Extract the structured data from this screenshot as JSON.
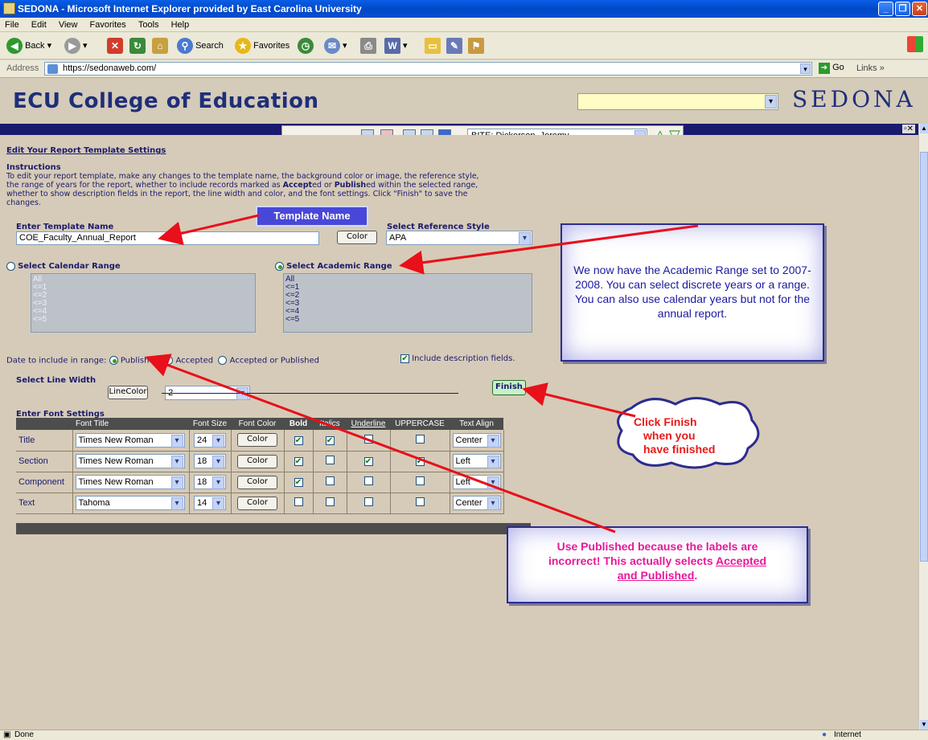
{
  "window": {
    "title": "SEDONA - Microsoft Internet Explorer provided by East Carolina University"
  },
  "menu": [
    "File",
    "Edit",
    "View",
    "Favorites",
    "Tools",
    "Help"
  ],
  "toolbar": {
    "back": "Back",
    "search": "Search",
    "favorites": "Favorites"
  },
  "address": {
    "label": "Address",
    "url": "https://sedonaweb.com/",
    "go": "Go",
    "links": "Links"
  },
  "banner": {
    "college": "ECU College of Education",
    "logo": "SEDONA"
  },
  "nav": {
    "user_select": "BITE: Dickerson, Jeremy"
  },
  "page": {
    "title": "Edit Your Report Template Settings",
    "instructions_heading": "Instructions",
    "instructions_1": "To edit your report template, make any changes to the template name, the background color or image, the reference style,",
    "instructions_2": "the range of years for the report, whether to include records marked as",
    "instructions_accepted": "Accept",
    "instructions_accepted_2": "ed or",
    "instructions_published": "Publish",
    "instructions_3": "ed within the selected range,",
    "instructions_4": "whether to show description fields in the report, the line width and color, and the font settings. Click \"Finish\" to save the",
    "instructions_5": "changes.",
    "template_name_label": "Enter Template Name",
    "template_name_value": "COE_Faculty_Annual_Report",
    "color_button": "Color",
    "reference_label": "Select Reference Style",
    "reference_value": "APA",
    "calendar_label": "Select Calendar Range",
    "academic_label": "Select Academic Range",
    "range_options": [
      "All",
      "<=1",
      "<=2",
      "<=3",
      "<=4",
      "<=5"
    ],
    "date_label": "Date to include in range:",
    "opt_published": "Published",
    "opt_accepted": "Accepted",
    "opt_accepted_or_published": "Accepted or Published",
    "include_desc": "Include description fields.",
    "line_width_label": "Select Line Width",
    "line_width_value": "2",
    "line_color_button": "LineColor",
    "finish_button": "Finish",
    "font_settings_label": "Enter Font Settings",
    "font_headers": [
      "Font Title",
      "Font Size",
      "Font Color",
      "Bold",
      "Italics",
      "Underline",
      "UPPERCASE",
      "Text Align"
    ],
    "font_rows": [
      {
        "label": "Title",
        "font": "Times New Roman",
        "size": "24",
        "bold": true,
        "italic": true,
        "underline": false,
        "upper": false,
        "align": "Center"
      },
      {
        "label": "Section",
        "font": "Times New Roman",
        "size": "18",
        "bold": true,
        "italic": false,
        "underline": true,
        "upper": true,
        "align": "Left"
      },
      {
        "label": "Component",
        "font": "Times New Roman",
        "size": "18",
        "bold": true,
        "italic": false,
        "underline": false,
        "upper": false,
        "align": "Left"
      },
      {
        "label": "Text",
        "font": "Tahoma",
        "size": "14",
        "bold": false,
        "italic": false,
        "underline": false,
        "upper": false,
        "align": "Center"
      }
    ]
  },
  "callouts": {
    "template_name": "Template Name",
    "academic": "We now have the Academic Range set to 2007-2008.  You can select discrete years or a range.  You can also use calendar years but not for the annual report.",
    "finish_1": "Click Finish",
    "finish_2": "when you",
    "finish_3": "have finished",
    "published_1": "Use Published because the labels are",
    "published_2": "incorrect! This actually selects",
    "published_3": "Accepted",
    "published_4": "and Published",
    "published_5": "."
  },
  "status": {
    "left": "Done",
    "right": "Internet"
  },
  "colors": {
    "banner_text": "#1e2e7a",
    "navbar": "#1a1a6e",
    "callout_fill": "#4848d8",
    "arrow": "#e8101a"
  }
}
